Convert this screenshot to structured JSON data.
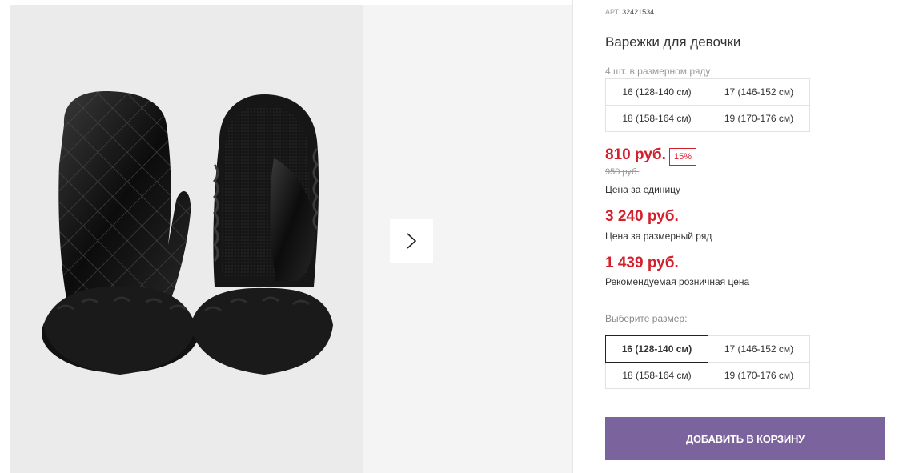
{
  "product": {
    "sku_label": "АРТ.",
    "sku_value": "32421534",
    "title": "Варежки для девочки",
    "pack_note": "4 шт. в размерном ряду",
    "pack_sizes": [
      "16 (128-140 см)",
      "17 (146-152 см)",
      "18 (158-164 см)",
      "19 (170-176 см)"
    ]
  },
  "pricing": {
    "unit_price": "810 руб.",
    "discount": "15%",
    "old_price": "950 руб.",
    "unit_caption": "Цена за единицу",
    "set_price": "3 240 руб.",
    "set_caption": "Цена за размерный ряд",
    "retail_price": "1 439 руб.",
    "retail_caption": "Рекомендуемая розничная цена"
  },
  "size_select": {
    "label": "Выберите размер:",
    "options": [
      "16 (128-140 см)",
      "17 (146-152 см)",
      "18 (158-164 см)",
      "19 (170-176 см)"
    ],
    "selected": "16 (128-140 см)"
  },
  "actions": {
    "add_to_cart": "ДОБАВИТЬ В КОРЗИНУ"
  },
  "colors": {
    "price_red": "#d4202c",
    "button_purple": "#7b639e"
  },
  "icons": {
    "gallery_next": "chevron-right-icon"
  }
}
